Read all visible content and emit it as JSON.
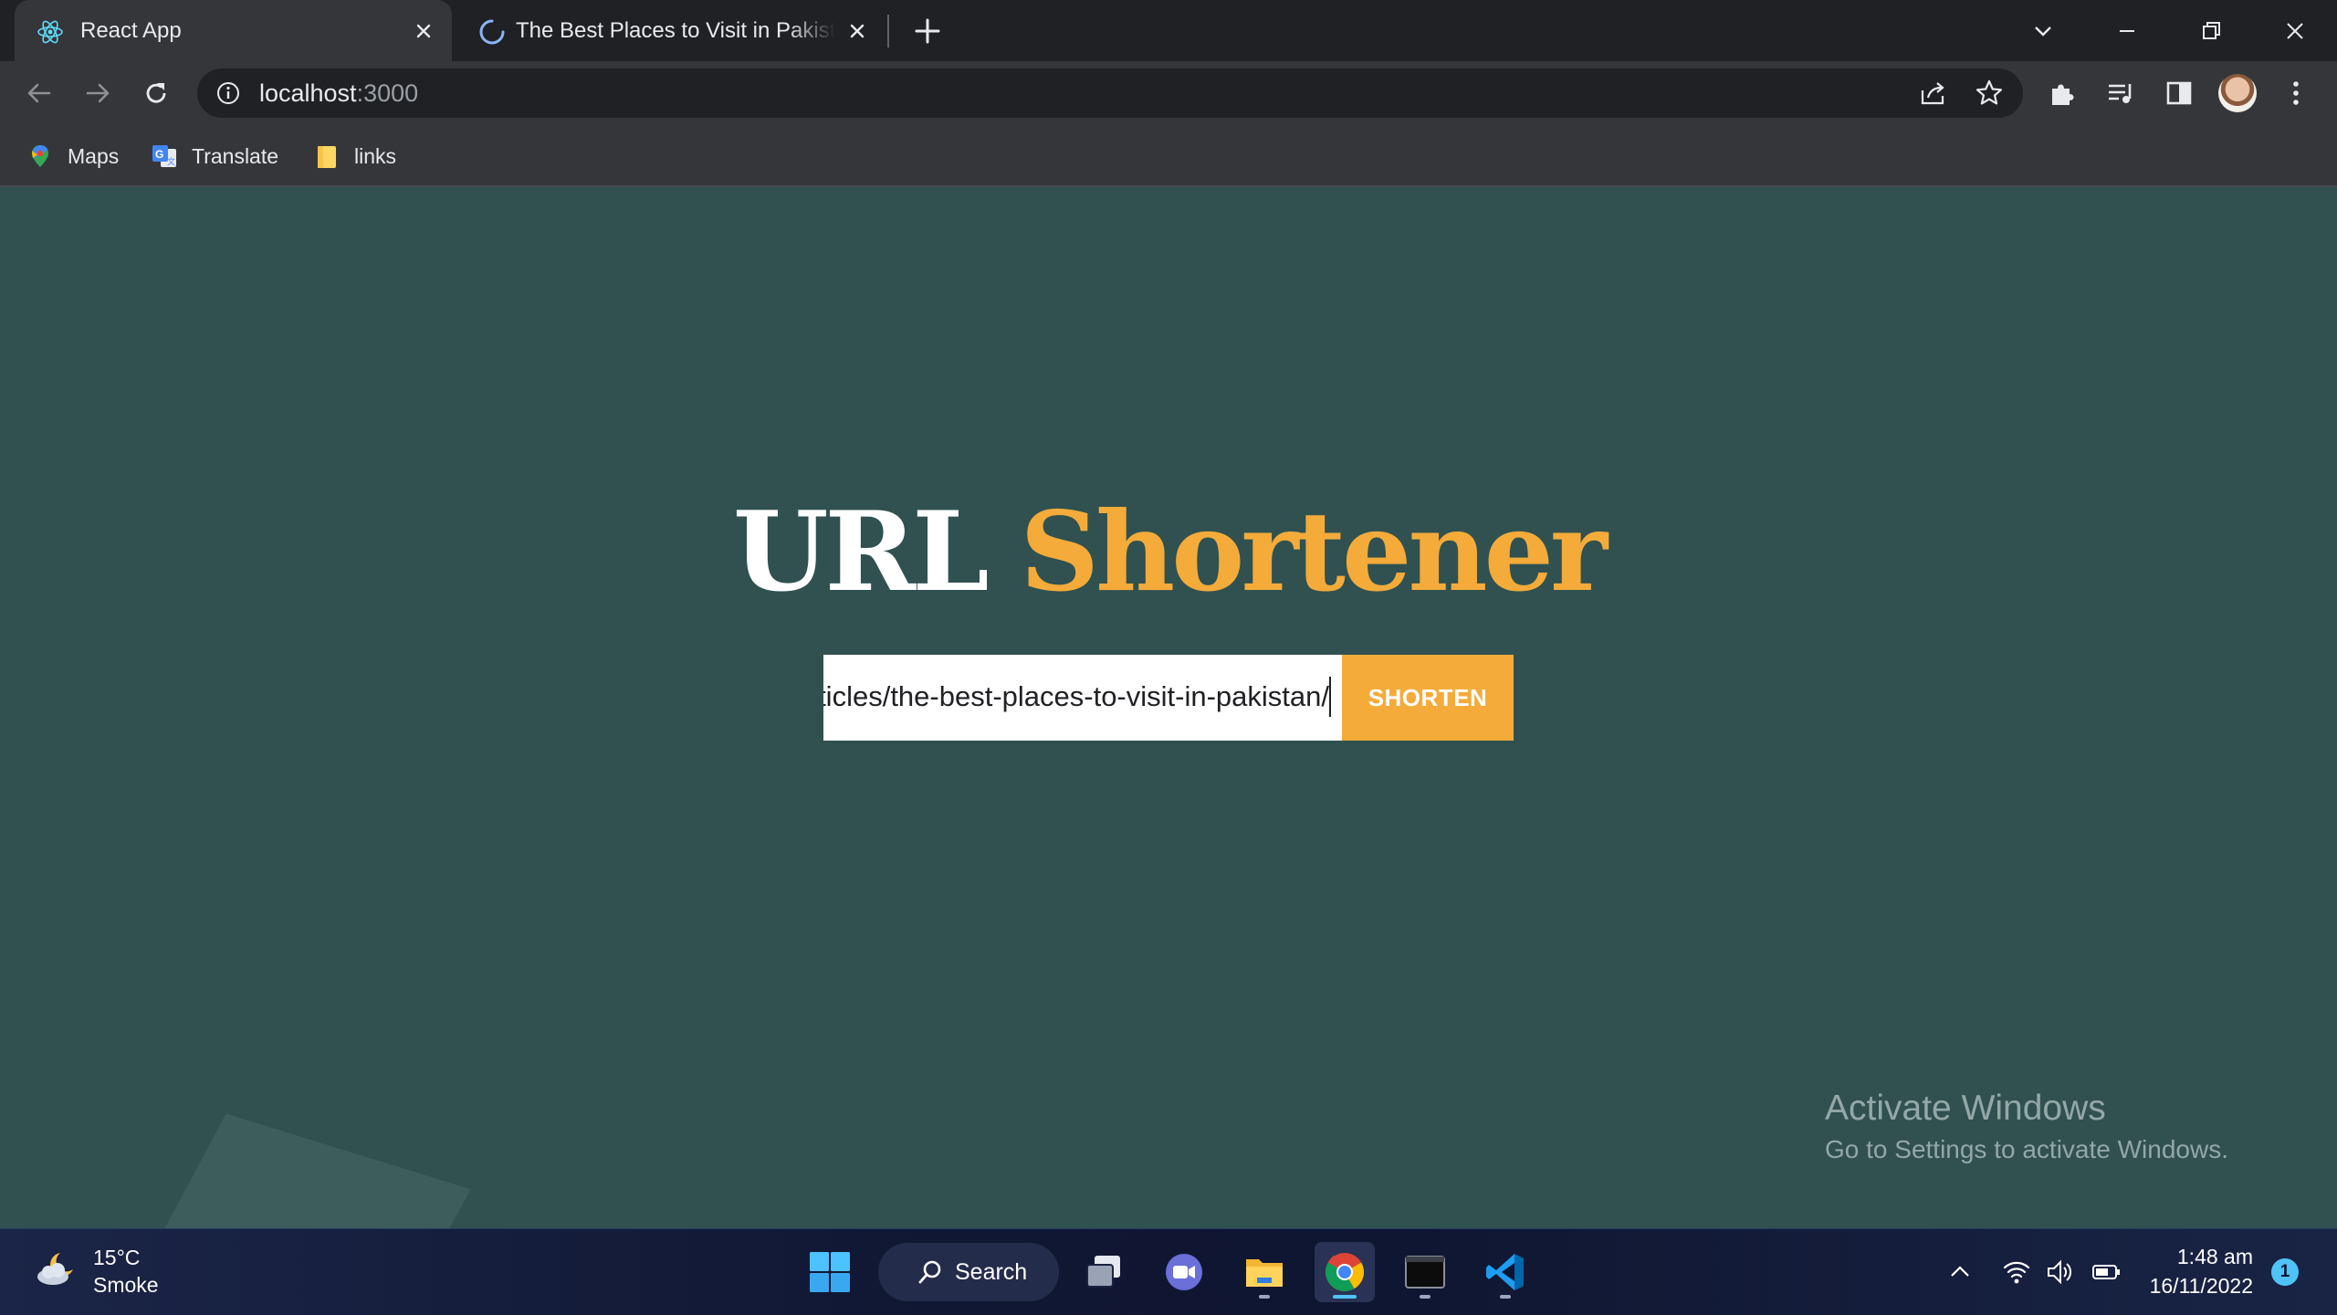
{
  "browser": {
    "tabs": [
      {
        "title": "React App",
        "favicon": "react-icon"
      },
      {
        "title": "The Best Places to Visit in Pakistan",
        "favicon": "loading-spinner-icon"
      }
    ],
    "address": {
      "host": "localhost",
      "port": ":3000"
    },
    "bookmarks": [
      {
        "label": "Maps",
        "icon": "maps-icon"
      },
      {
        "label": "Translate",
        "icon": "translate-icon"
      },
      {
        "label": "links",
        "icon": "folder-icon"
      }
    ]
  },
  "page": {
    "headline_word1": "URL",
    "headline_word2": "Shortener",
    "input_value": "https://www.example.com/articles/the-best-places-to-visit-in-pakistan/",
    "button_label": "SHORTEN",
    "activate_title": "Activate Windows",
    "activate_subtitle": "Go to Settings to activate Windows."
  },
  "taskbar": {
    "weather_temp": "15°C",
    "weather_desc": "Smoke",
    "search_label": "Search",
    "time": "1:48 am",
    "date": "16/11/2022",
    "notification_count": "1"
  },
  "colors": {
    "page_bg": "#305150",
    "accent": "#f4ab3a",
    "chrome_dark": "#202124",
    "chrome_toolbar": "#35363a"
  }
}
